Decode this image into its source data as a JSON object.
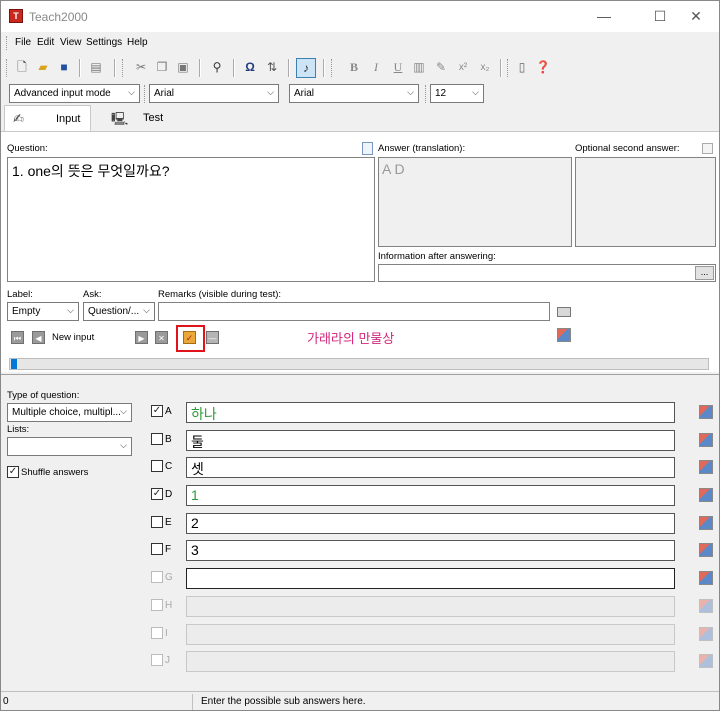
{
  "window": {
    "title": "Teach2000",
    "app_icon": "T",
    "min": "—",
    "max": "☐",
    "close": "✕"
  },
  "menu": [
    "File",
    "Edit",
    "View",
    "Settings",
    "Help"
  ],
  "toolbar": {
    "mode_select": "Advanced input mode",
    "font_question": "Arial",
    "font_answer": "Arial",
    "font_size": "12"
  },
  "tabs": [
    {
      "label": "Input",
      "icon": "pencil-icon"
    },
    {
      "label": "Test",
      "icon": "monitor-icon"
    }
  ],
  "question": {
    "label": "Question:",
    "text": "1. one의 뜻은 무엇일까요?"
  },
  "answer": {
    "label": "Answer (translation):",
    "text": "A D"
  },
  "second_answer": {
    "label": "Optional second answer:"
  },
  "info_after": {
    "label": "Information after answering:",
    "button": "..."
  },
  "meta": {
    "label_label": "Label:",
    "label_value": "Empty",
    "ask_label": "Ask:",
    "ask_value": "Question/...",
    "remarks_label": "Remarks (visible during test):",
    "remarks_value": ""
  },
  "nav": {
    "new_input": "New input",
    "annotation": "가래라의 만물상"
  },
  "question_type": {
    "label": "Type of question:",
    "value": "Multiple choice, multipl..."
  },
  "lists": {
    "label": "Lists:",
    "value": ""
  },
  "shuffle": {
    "label": "Shuffle answers",
    "checked": true
  },
  "answers": [
    {
      "letter": "A",
      "checked": true,
      "enabled": true,
      "text": "하나",
      "color": "#2e9b3a"
    },
    {
      "letter": "B",
      "checked": false,
      "enabled": true,
      "text": "둘",
      "color": "#000000"
    },
    {
      "letter": "C",
      "checked": false,
      "enabled": true,
      "text": "셋",
      "color": "#000000"
    },
    {
      "letter": "D",
      "checked": true,
      "enabled": true,
      "text": "1",
      "color": "#2e9b3a"
    },
    {
      "letter": "E",
      "checked": false,
      "enabled": true,
      "text": "2",
      "color": "#000000"
    },
    {
      "letter": "F",
      "checked": false,
      "enabled": true,
      "text": "3",
      "color": "#000000"
    },
    {
      "letter": "G",
      "checked": false,
      "enabled": true,
      "text": "",
      "color": "#000000"
    },
    {
      "letter": "H",
      "checked": false,
      "enabled": false,
      "text": "",
      "color": "#000000"
    },
    {
      "letter": "I",
      "checked": false,
      "enabled": false,
      "text": "",
      "color": "#000000"
    },
    {
      "letter": "J",
      "checked": false,
      "enabled": false,
      "text": "",
      "color": "#000000"
    }
  ],
  "status": {
    "count": "0",
    "hint": "Enter the possible sub answers here."
  },
  "colors": {
    "highlight_frame": "#e0121a",
    "annotation_text": "#d4277c",
    "active_tool": "#3c7fb1"
  }
}
